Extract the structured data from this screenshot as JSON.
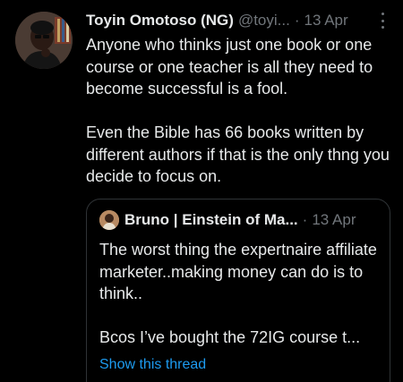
{
  "tweet": {
    "author_name": "Toyin Omotoso (NG)",
    "author_handle": "@toyi...",
    "separator": "·",
    "timestamp": "13 Apr",
    "paragraphs": [
      "Anyone who thinks just one book or one course or one teacher is all they need to become successful is a fool.",
      "Even the Bible has 66 books written by different authors if that is the only thng you decide to focus on."
    ]
  },
  "quoted_tweet": {
    "author_name": "Bruno | Einstein of Ma...",
    "separator": "·",
    "timestamp": "13 Apr",
    "paragraphs": [
      "The worst thing the expertnaire affiliate marketer..making money can do is to think..",
      "Bcos I’ve bought the 72IG course t..."
    ],
    "show_thread_label": "Show this thread"
  },
  "colors": {
    "background": "#000000",
    "primary_text": "#e7e9ea",
    "secondary_text": "#71767b",
    "accent_link": "#1d9bf0",
    "border": "#2f3336"
  },
  "icons": {
    "more": "more-options-icon"
  }
}
